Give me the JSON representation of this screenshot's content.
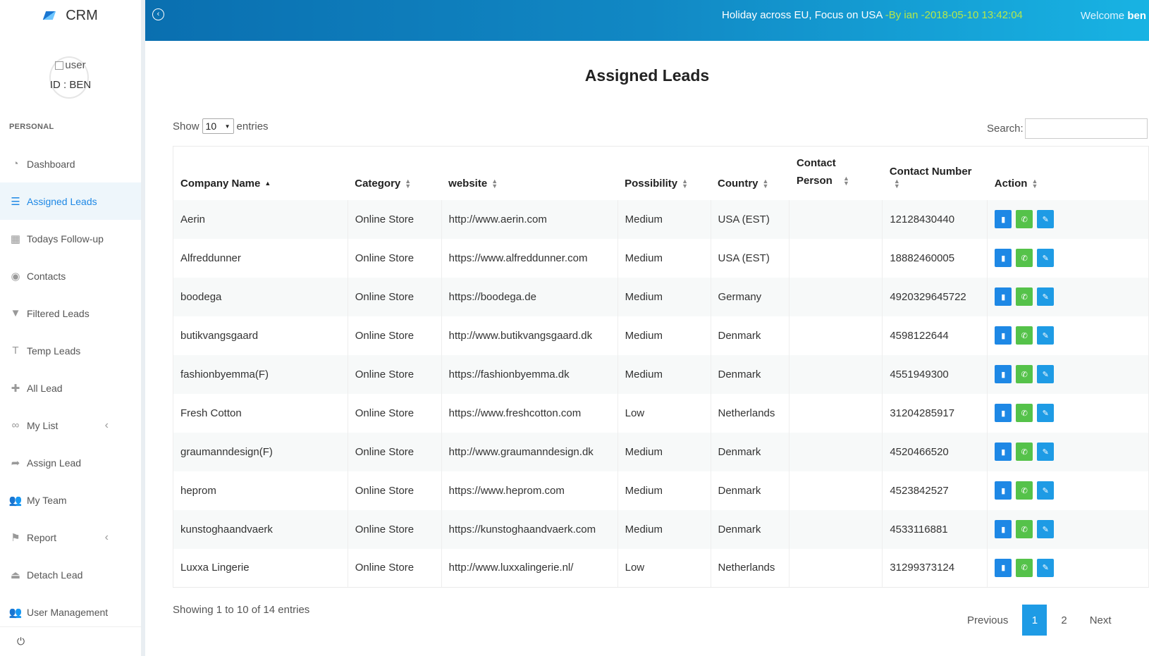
{
  "app": {
    "brand": "CRM"
  },
  "profile": {
    "image_alt": "user",
    "id_label": "ID : BEN"
  },
  "sidebar": {
    "section": "PERSONAL",
    "items": [
      {
        "label": "Dashboard",
        "icon": "dashboard-icon",
        "glyph": "◔"
      },
      {
        "label": "Assigned Leads",
        "icon": "list-icon",
        "glyph": "☰"
      },
      {
        "label": "Todays Follow-up",
        "icon": "calendar-icon",
        "glyph": "▦"
      },
      {
        "label": "Contacts",
        "icon": "user-circle-icon",
        "glyph": "◉"
      },
      {
        "label": "Filtered Leads",
        "icon": "filter-icon",
        "glyph": "▼"
      },
      {
        "label": "Temp Leads",
        "icon": "text-icon",
        "glyph": "T"
      },
      {
        "label": "All Lead",
        "icon": "plus-icon",
        "glyph": "✚"
      },
      {
        "label": "My List",
        "icon": "link-icon",
        "glyph": "∞"
      },
      {
        "label": "Assign Lead",
        "icon": "share-icon",
        "glyph": "➦"
      },
      {
        "label": "My Team",
        "icon": "team-icon",
        "glyph": "👥"
      },
      {
        "label": "Report",
        "icon": "flag-icon",
        "glyph": "⚑"
      },
      {
        "label": "Detach Lead",
        "icon": "eject-icon",
        "glyph": "⏏"
      },
      {
        "label": "User Management",
        "icon": "users-icon",
        "glyph": "👥"
      }
    ],
    "logout_glyph": "⏻"
  },
  "header": {
    "notice": "Holiday across EU, Focus on USA",
    "notice_by": "-By ian -2018-05-10 13:42:04",
    "welcome": "Welcome",
    "user": "ben"
  },
  "page": {
    "title": "Assigned Leads",
    "show": "Show",
    "entries_value": "10",
    "entries": "entries",
    "search_label": "Search:",
    "search_value": ""
  },
  "table": {
    "headers": [
      "Company Name",
      "Category",
      "website",
      "Possibility",
      "Country",
      "Contact Person",
      "Contact Number",
      "Action"
    ],
    "rows": [
      [
        "Aerin",
        "Online Store",
        "http://www.aerin.com",
        "Medium",
        "USA (EST)",
        "",
        "12128430440"
      ],
      [
        "Alfreddunner",
        "Online Store",
        "https://www.alfreddunner.com",
        "Medium",
        "USA (EST)",
        "",
        "18882460005"
      ],
      [
        "boodega",
        "Online Store",
        "https://boodega.de",
        "Medium",
        "Germany",
        "",
        "4920329645722"
      ],
      [
        "butikvangsgaard",
        "Online Store",
        "http://www.butikvangsgaard.dk",
        "Medium",
        "Denmark",
        "",
        "4598122644"
      ],
      [
        "fashionbyemma(F)",
        "Online Store",
        "https://fashionbyemma.dk",
        "Medium",
        "Denmark",
        "",
        "4551949300"
      ],
      [
        "Fresh Cotton",
        "Online Store",
        "https://www.freshcotton.com",
        "Low",
        "Netherlands",
        "",
        "31204285917"
      ],
      [
        "graumanndesign(F)",
        "Online Store",
        "http://www.graumanndesign.dk",
        "Medium",
        "Denmark",
        "",
        "4520466520"
      ],
      [
        "heprom",
        "Online Store",
        "https://www.heprom.com",
        "Medium",
        "Denmark",
        "",
        "4523842527"
      ],
      [
        "kunstoghaandvaerk",
        "Online Store",
        "https://kunstoghaandvaerk.com",
        "Medium",
        "Denmark",
        "",
        "4533116881"
      ],
      [
        "Luxxa Lingerie",
        "Online Store",
        "http://www.luxxalingerie.nl/",
        "Low",
        "Netherlands",
        "",
        "31299373124"
      ]
    ]
  },
  "footer": {
    "info": "Showing 1 to 10 of 14 entries",
    "previous": "Previous",
    "pages": [
      "1",
      "2"
    ],
    "next": "Next"
  },
  "colors": {
    "accent": "#1e88e5",
    "success": "#55c24a",
    "header_start": "#0a6fb0",
    "header_end": "#18b3e3"
  }
}
